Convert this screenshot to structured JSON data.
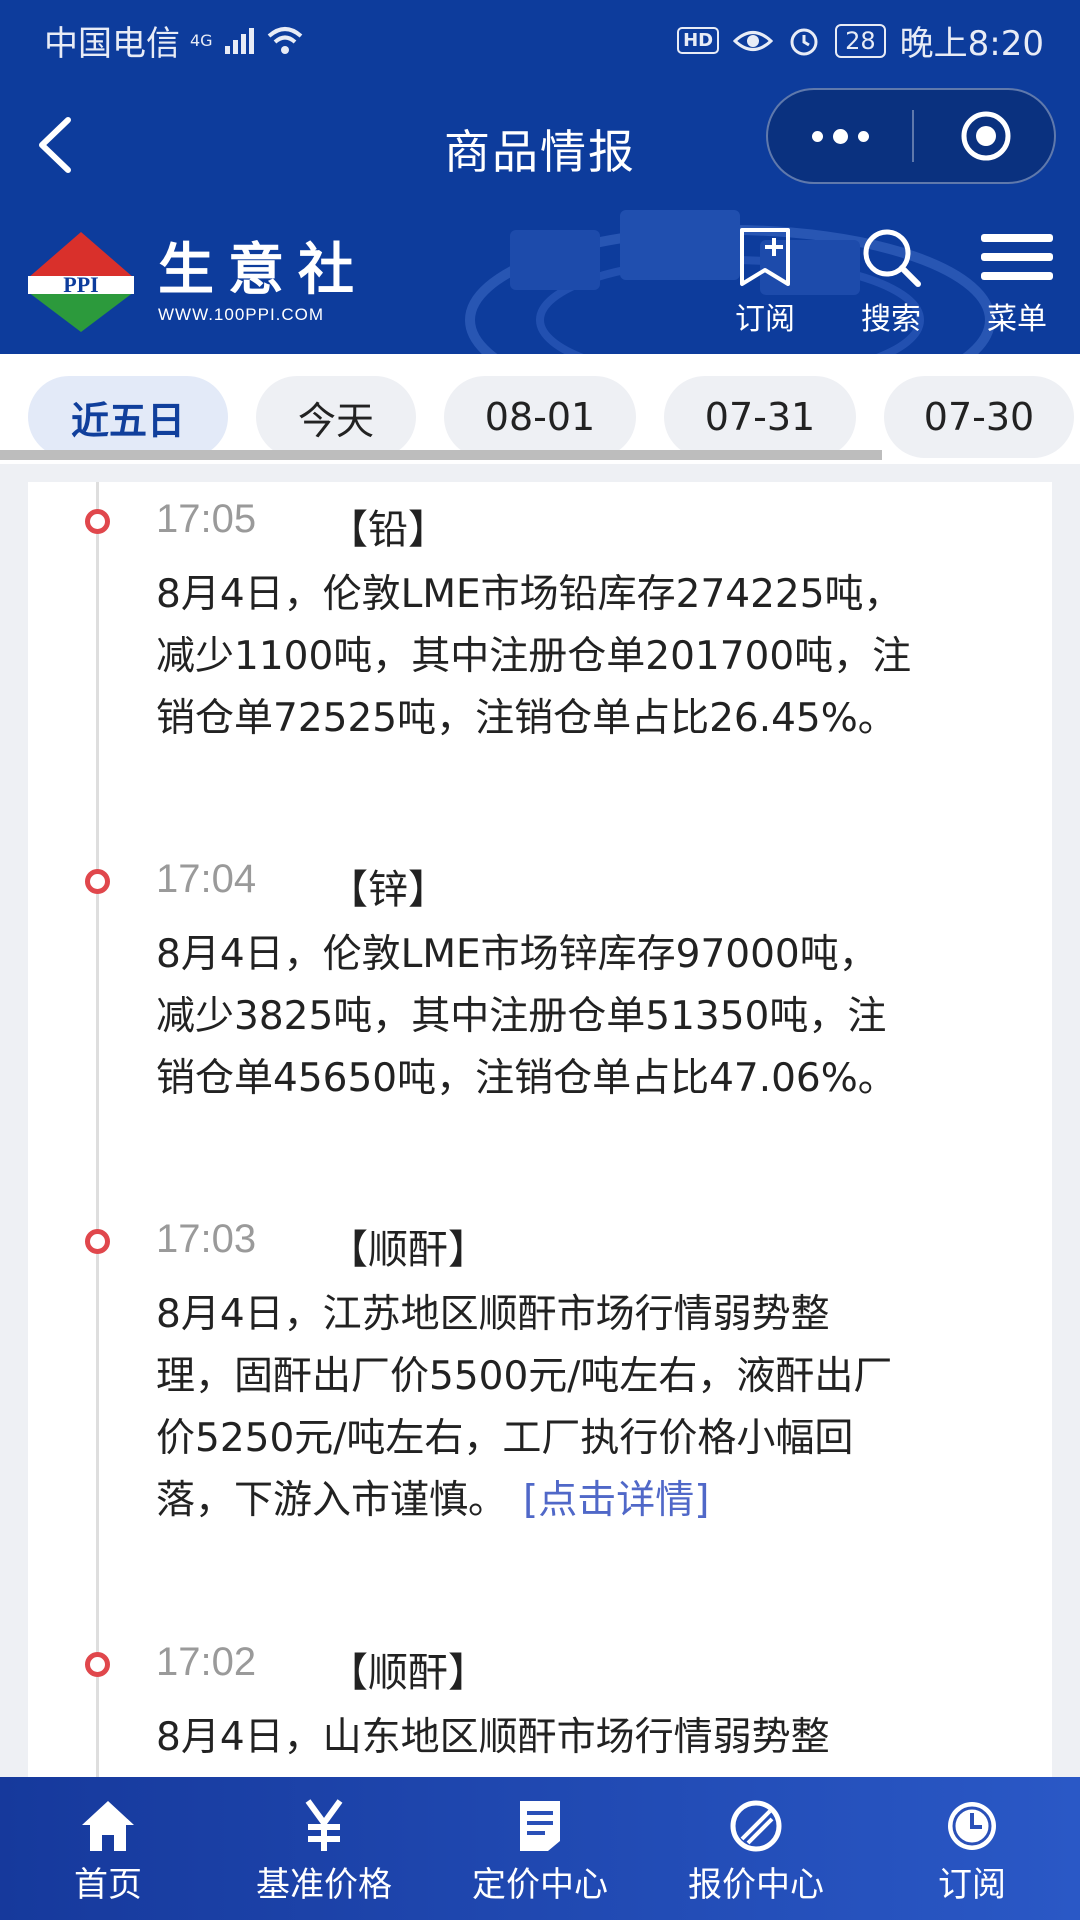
{
  "status_bar": {
    "carrier": "中国电信",
    "network": "4G",
    "hd": "HD",
    "battery": "28",
    "time": "晚上8:20"
  },
  "nav": {
    "title": "商品情报",
    "back_icon": "chevron-left-icon",
    "more_icon": "more-dots-icon",
    "close_icon": "target-close-icon"
  },
  "brand": {
    "logo_text": "PPI",
    "name": "生意社",
    "url": "WWW.100PPI.COM"
  },
  "toolbar": [
    {
      "label": "订阅",
      "icon": "bookmark-plus-icon"
    },
    {
      "label": "搜索",
      "icon": "search-icon"
    },
    {
      "label": "菜单",
      "icon": "menu-icon"
    }
  ],
  "tabs": [
    {
      "label": "近五日",
      "active": true
    },
    {
      "label": "今天",
      "active": false
    },
    {
      "label": "08-01",
      "active": false
    },
    {
      "label": "07-31",
      "active": false
    },
    {
      "label": "07-30",
      "active": false
    }
  ],
  "entries": [
    {
      "time": "17:05",
      "tag": "【铅】",
      "lines": [
        "8月4日，伦敦LME市场铅库存274225吨，",
        "减少1100吨，其中注册仓单201700吨，注",
        "销仓单72525吨，注销仓单占比26.45%。"
      ]
    },
    {
      "time": "17:04",
      "tag": "【锌】",
      "lines": [
        "8月4日，伦敦LME市场锌库存97000吨，",
        "减少3825吨，其中注册仓单51350吨，注",
        "销仓单45650吨，注销仓单占比47.06%。"
      ]
    },
    {
      "time": "17:03",
      "tag": "【顺酐】",
      "lines": [
        "8月4日，江苏地区顺酐市场行情弱势整",
        "理，固酐出厂价5500元/吨左右，液酐出厂",
        "价5250元/吨左右，工厂执行价格小幅回",
        "落，下游入市谨慎。"
      ],
      "link": "[点击详情]"
    },
    {
      "time": "17:02",
      "tag": "【顺酐】",
      "lines": [
        "8月4日，山东地区顺酐市场行情弱势整"
      ]
    }
  ],
  "bottom_nav": [
    {
      "label": "首页",
      "icon": "home-icon"
    },
    {
      "label": "基准价格",
      "icon": "yen-icon"
    },
    {
      "label": "定价中心",
      "icon": "document-icon"
    },
    {
      "label": "报价中心",
      "icon": "quote-slash-icon"
    },
    {
      "label": "订阅",
      "icon": "clock-icon"
    }
  ],
  "colors": {
    "header_bg": "#0d3c9c",
    "timeline_node": "#e0474c",
    "link": "#5068c8",
    "active_tab_text": "#103f9c"
  }
}
